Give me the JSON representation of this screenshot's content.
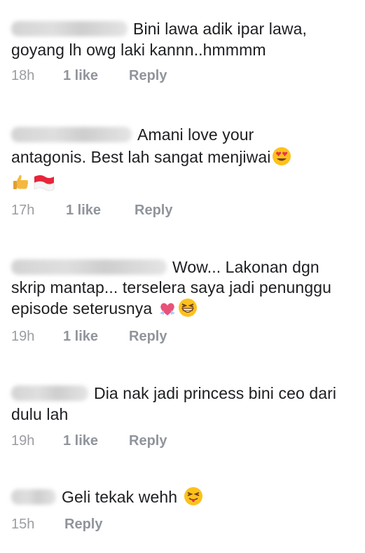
{
  "comments": [
    {
      "text_line1": "Bini lawa adik ipar lawa,",
      "text_line2": "goyang lh owg laki kannn..hmmmm",
      "time": "18h",
      "likes": "1 like",
      "reply": "Reply"
    },
    {
      "text_line1": "Amani love your",
      "text_line2": "antagonis. Best lah sangat menjiwai",
      "time": "17h",
      "likes": "1 like",
      "reply": "Reply",
      "emojis": [
        "heart-eyes-emoji",
        "thumbs-up-emoji",
        "indonesia-flag-emoji"
      ]
    },
    {
      "text_line1": "Wow... Lakonan dgn",
      "text_line2": "skrip mantap... terselera saya jadi penunggu",
      "text_line3": "episode seterusnya",
      "time": "19h",
      "likes": "1 like",
      "reply": "Reply",
      "emojis": [
        "heart-ribbon-emoji",
        "grinning-squint-emoji"
      ]
    },
    {
      "text_line1": "Dia nak jadi princess bini ceo dari",
      "text_line2": "dulu lah",
      "time": "19h",
      "likes": "1 like",
      "reply": "Reply"
    },
    {
      "text_line1": "Geli tekak wehh",
      "time": "15h",
      "reply": "Reply",
      "emojis": [
        "squinting-tongue-emoji"
      ]
    }
  ],
  "colors": {
    "text": "#1c1e21",
    "meta": "#90949c",
    "background": "#ffffff"
  }
}
